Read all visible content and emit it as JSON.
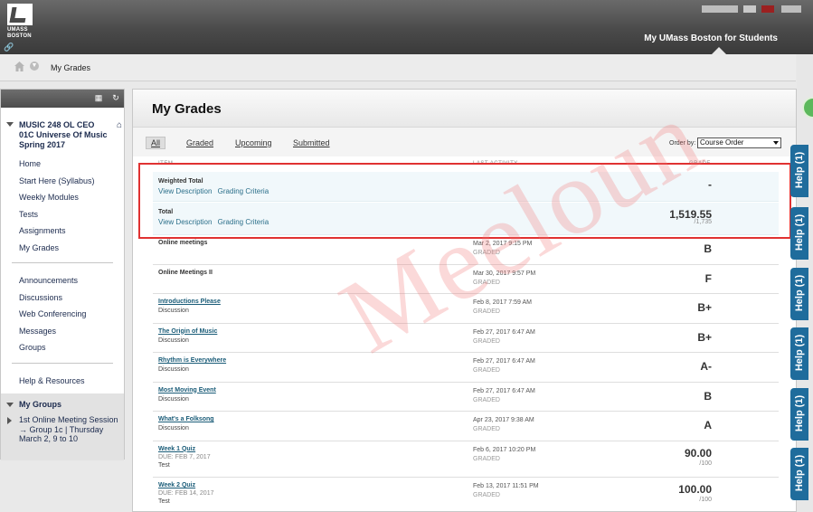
{
  "header": {
    "logo_text": [
      "UMASS",
      "BOSTON"
    ],
    "tab_label": "My UMass Boston for Students"
  },
  "breadcrumb": {
    "current": "My Grades"
  },
  "course_menu": {
    "course_title": "MUSIC 248 OL CEO 01C Universe Of Music Spring 2017",
    "items_group1": [
      "Home",
      "Start Here (Syllabus)",
      "Weekly Modules",
      "Tests",
      "Assignments",
      "My Grades"
    ],
    "items_group2": [
      "Announcements",
      "Discussions",
      "Web Conferencing",
      "Messages",
      "Groups"
    ],
    "items_group3": [
      "Help & Resources"
    ],
    "my_groups": {
      "header": "My Groups",
      "group": "1st Online Meeting Session → Group 1c | Thursday March 2, 9 to 10"
    }
  },
  "main": {
    "title": "My Grades",
    "filters": [
      "All",
      "Graded",
      "Upcoming",
      "Submitted"
    ],
    "active_filter": "All",
    "order_by_label": "Order by:",
    "order_by_value": "Course Order",
    "columns": [
      "ITEM",
      "LAST ACTIVITY",
      "GRADE"
    ],
    "totals": [
      {
        "label": "Weighted Total",
        "links": [
          "View Description",
          "Grading Criteria"
        ],
        "grade": "-",
        "possible": ""
      },
      {
        "label": "Total",
        "links": [
          "View Description",
          "Grading Criteria"
        ],
        "grade": "1,519.55",
        "possible": "/1,735"
      }
    ],
    "rows": [
      {
        "title": "Online meetings",
        "link": false,
        "due": "",
        "category": "",
        "date": "Mar 2, 2017 9:15 PM",
        "status": "GRADED",
        "grade": "B",
        "possible": ""
      },
      {
        "title": "Online Meetings II",
        "link": false,
        "due": "",
        "category": "",
        "date": "Mar 30, 2017 9:57 PM",
        "status": "GRADED",
        "grade": "F",
        "possible": ""
      },
      {
        "title": "Introductions Please",
        "link": true,
        "due": "",
        "category": "Discussion",
        "date": "Feb 8, 2017 7:59 AM",
        "status": "GRADED",
        "grade": "B+",
        "possible": ""
      },
      {
        "title": "The Origin of Music",
        "link": true,
        "due": "",
        "category": "Discussion",
        "date": "Feb 27, 2017 6:47 AM",
        "status": "GRADED",
        "grade": "B+",
        "possible": ""
      },
      {
        "title": "Rhythm is Everywhere",
        "link": true,
        "due": "",
        "category": "Discussion",
        "date": "Feb 27, 2017 6:47 AM",
        "status": "GRADED",
        "grade": "A-",
        "possible": ""
      },
      {
        "title": "Most Moving Event",
        "link": true,
        "due": "",
        "category": "Discussion",
        "date": "Feb 27, 2017 6:47 AM",
        "status": "GRADED",
        "grade": "B",
        "possible": ""
      },
      {
        "title": "What's a Folksong",
        "link": true,
        "due": "",
        "category": "Discussion",
        "date": "Apr 23, 2017 9:38 AM",
        "status": "GRADED",
        "grade": "A",
        "possible": ""
      },
      {
        "title": "Week 1 Quiz",
        "link": true,
        "due": "DUE: FEB 7, 2017",
        "category": "Test",
        "date": "Feb 6, 2017 10:20 PM",
        "status": "GRADED",
        "grade": "90.00",
        "possible": "/100"
      },
      {
        "title": "Week 2 Quiz",
        "link": true,
        "due": "DUE: FEB 14, 2017",
        "category": "Test",
        "date": "Feb 13, 2017 11:51 PM",
        "status": "GRADED",
        "grade": "100.00",
        "possible": "/100"
      }
    ]
  },
  "help_tabs": [
    "Help (1)",
    "Help (1)",
    "Help (1)",
    "Help (1)",
    "Help (1)",
    "Help (1)"
  ],
  "watermark": "Meeloun",
  "colors": {
    "header": "#4a4a4a",
    "link": "#1a5c78",
    "help_tab": "#1f6c9c",
    "highlight": "#e03232"
  }
}
